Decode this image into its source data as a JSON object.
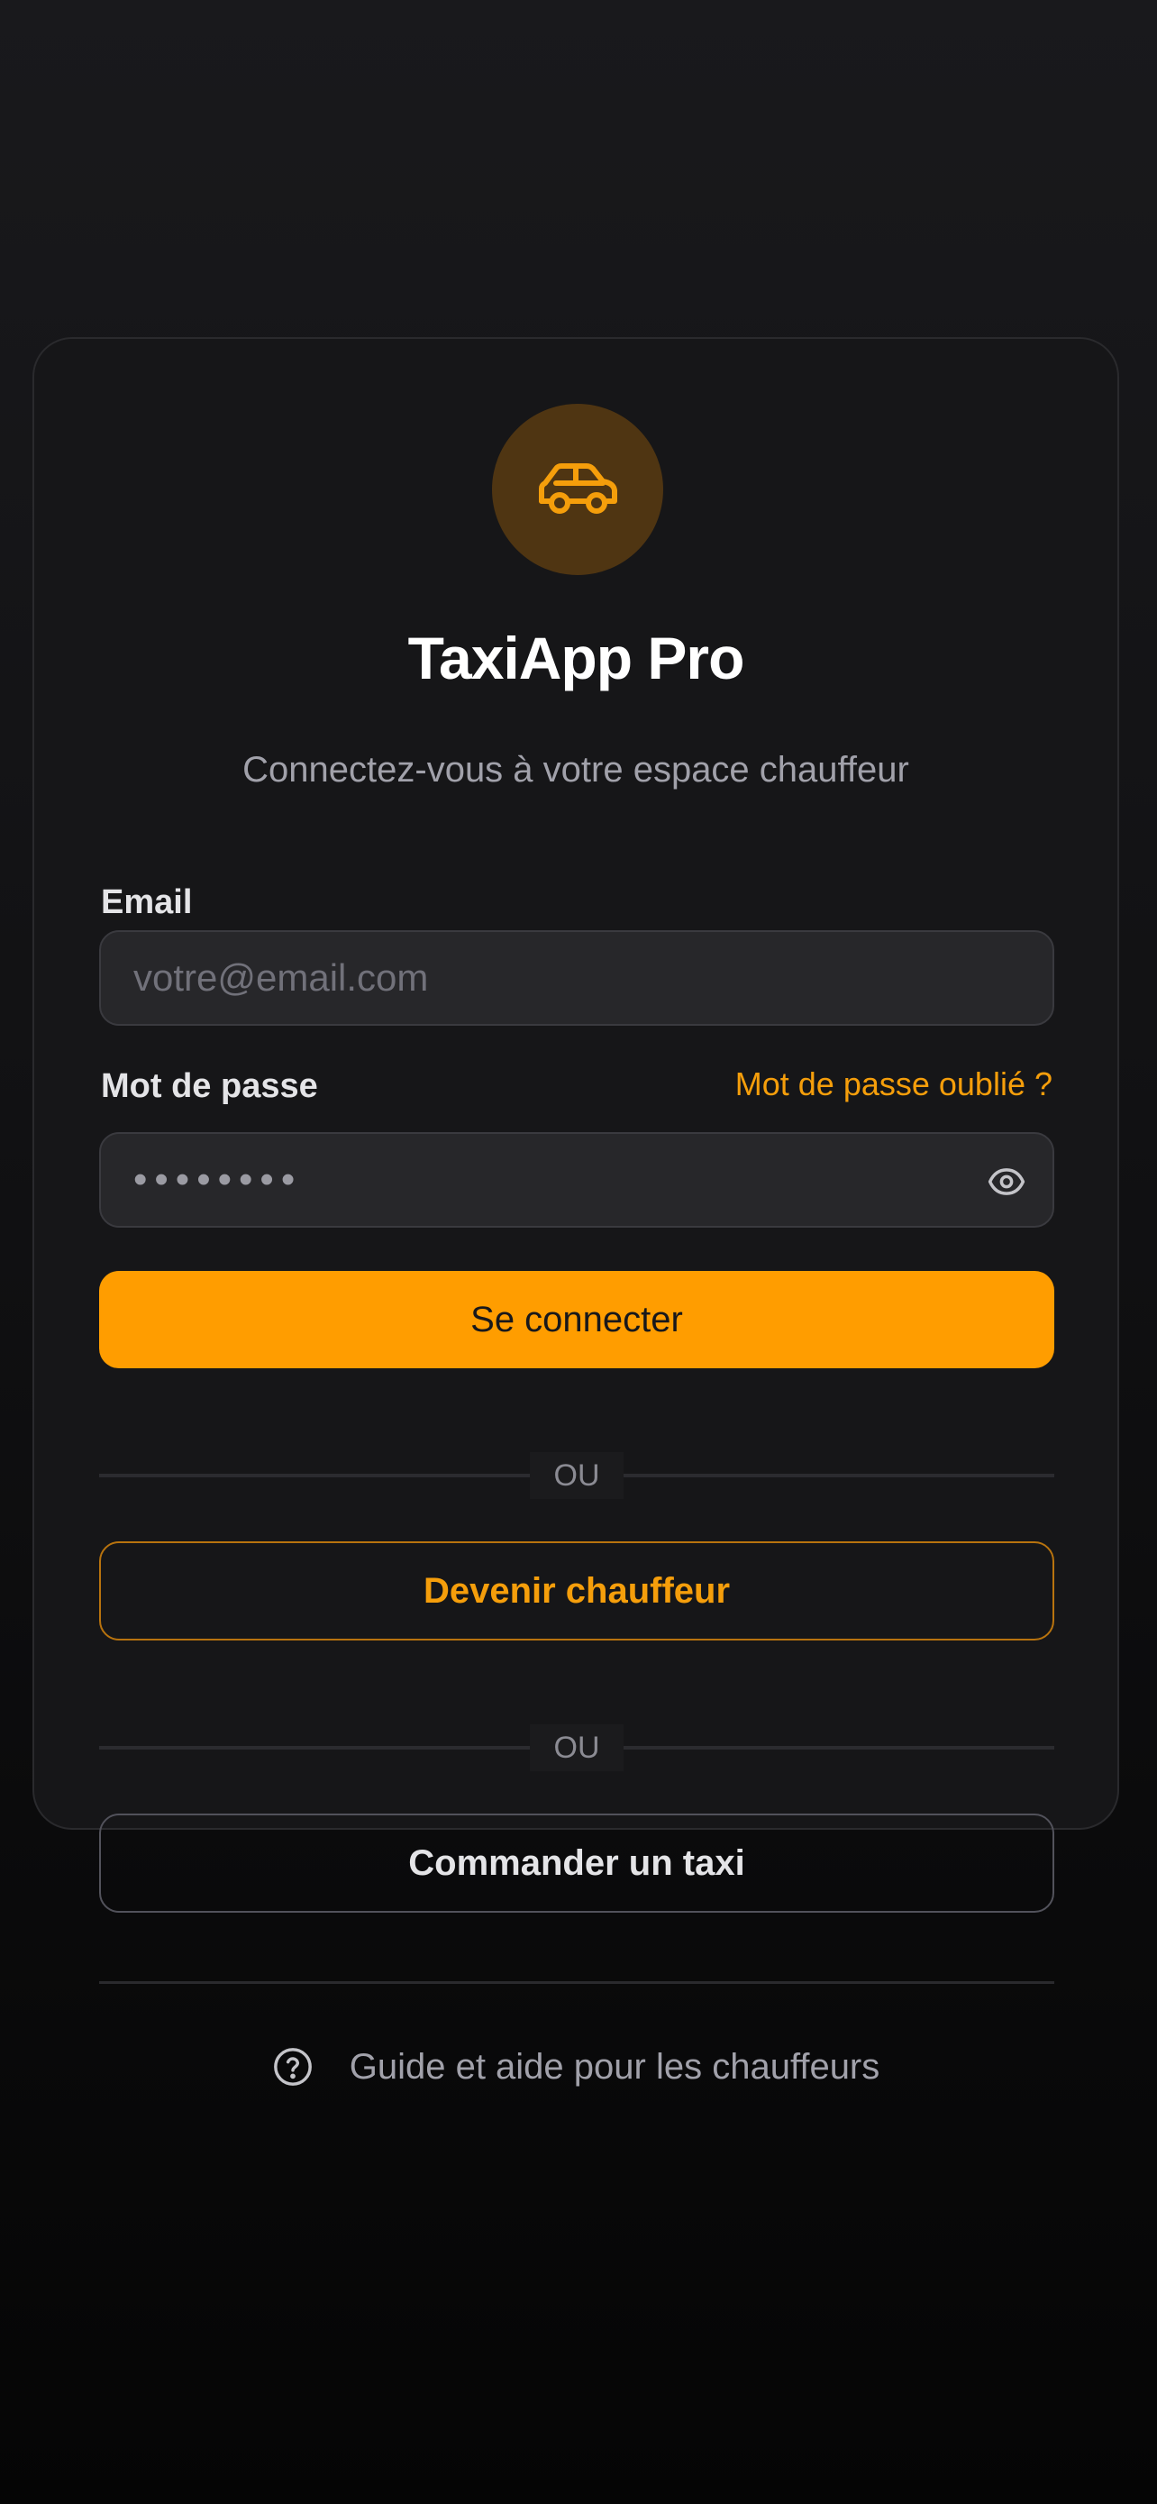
{
  "app": {
    "title": "TaxiApp Pro",
    "subtitle": "Connectez-vous à votre espace chauffeur",
    "logo_icon": "car-icon"
  },
  "form": {
    "email_label": "Email",
    "email_placeholder": "votre@email.com",
    "password_label": "Mot de passe",
    "password_mask": "••••••••",
    "forgot_link": "Mot de passe oublié ?",
    "password_toggle_icon": "eye-icon",
    "submit_label": "Se connecter"
  },
  "separators": {
    "first": "OU",
    "second": "OU"
  },
  "actions": {
    "become_driver": "Devenir chauffeur",
    "order_taxi": "Commander un taxi"
  },
  "help": {
    "icon": "help-circle-icon",
    "label": "Guide et aide pour les chauffeurs"
  },
  "colors": {
    "accent": "#ff9d00",
    "background": "#161618",
    "input_background": "#27272a"
  }
}
